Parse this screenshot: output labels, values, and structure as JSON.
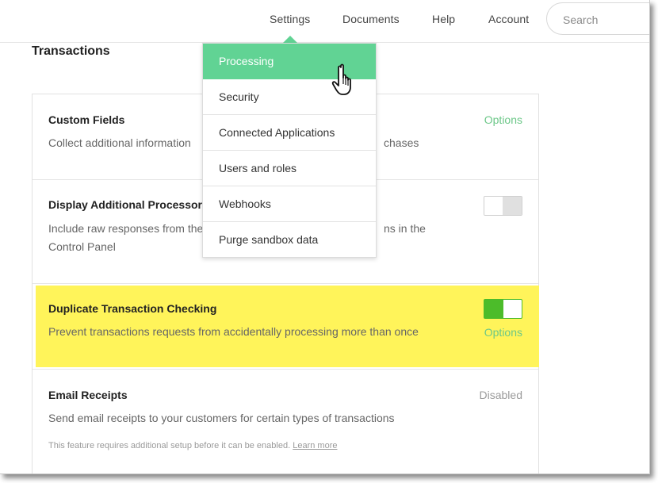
{
  "nav": {
    "settings": "Settings",
    "documents": "Documents",
    "help": "Help",
    "account": "Account",
    "search_placeholder": "Search"
  },
  "page": {
    "title": "Transactions"
  },
  "settings_menu": {
    "items": [
      {
        "label": "Processing",
        "active": true
      },
      {
        "label": "Security"
      },
      {
        "label": "Connected Applications"
      },
      {
        "label": "Users and roles"
      },
      {
        "label": "Webhooks"
      },
      {
        "label": "Purge sandbox data"
      }
    ]
  },
  "rows": [
    {
      "title": "Custom Fields",
      "desc": "Collect additional information",
      "desc_tail": "chases",
      "action": "Options"
    },
    {
      "title": "Display Additional Processor F",
      "desc_line1": "Include raw responses from the",
      "desc_line1_tail": "ns in the",
      "desc_line2": "Control Panel",
      "toggle": "off"
    },
    {
      "title": "Duplicate Transaction Checking",
      "desc": "Prevent transactions requests from accidentally processing more than once",
      "action": "Options",
      "toggle": "on"
    },
    {
      "title": "Email Receipts",
      "desc": "Send email receipts to your customers for certain types of transactions",
      "status": "Disabled",
      "note": "This feature requires additional setup before it can be enabled.",
      "note_link": "Learn more"
    }
  ],
  "colors": {
    "accent_green": "#61d394",
    "link_green": "#6cc788",
    "toggle_green": "#4cbc2a",
    "highlight_yellow": "#fff45a"
  },
  "icons": {
    "cursor": "hand-pointer-icon"
  }
}
